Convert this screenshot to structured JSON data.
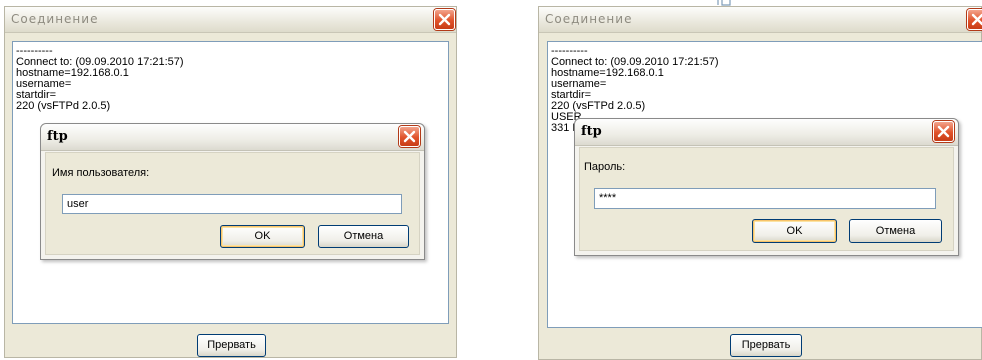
{
  "left": {
    "window_title": "Соединение",
    "log_lines": [
      "----------",
      "Connect to: (09.09.2010 17:21:57)",
      "hostname=192.168.0.1",
      "username=",
      "startdir=",
      "220 (vsFTPd 2.0.5)"
    ],
    "abort_label": "Прервать",
    "dialog": {
      "title": "ftp",
      "prompt": "Имя пользователя:",
      "input_value": "user",
      "ok_label": "OK",
      "cancel_label": "Отмена"
    }
  },
  "right": {
    "window_title": "Соединение",
    "log_lines": [
      "----------",
      "Connect to: (09.09.2010 17:21:57)",
      "hostname=192.168.0.1",
      "username=",
      "startdir=",
      "220 (vsFTPd 2.0.5)",
      "USER",
      "331 P"
    ],
    "abort_label": "Прервать",
    "dialog": {
      "title": "ftp",
      "prompt": "Пароль:",
      "input_value": "****",
      "ok_label": "OK",
      "cancel_label": "Отмена"
    }
  },
  "colors": {
    "close_red": "#e0532b",
    "window_bg": "#ece9d8",
    "default_button_glow": "#f7c36b"
  }
}
